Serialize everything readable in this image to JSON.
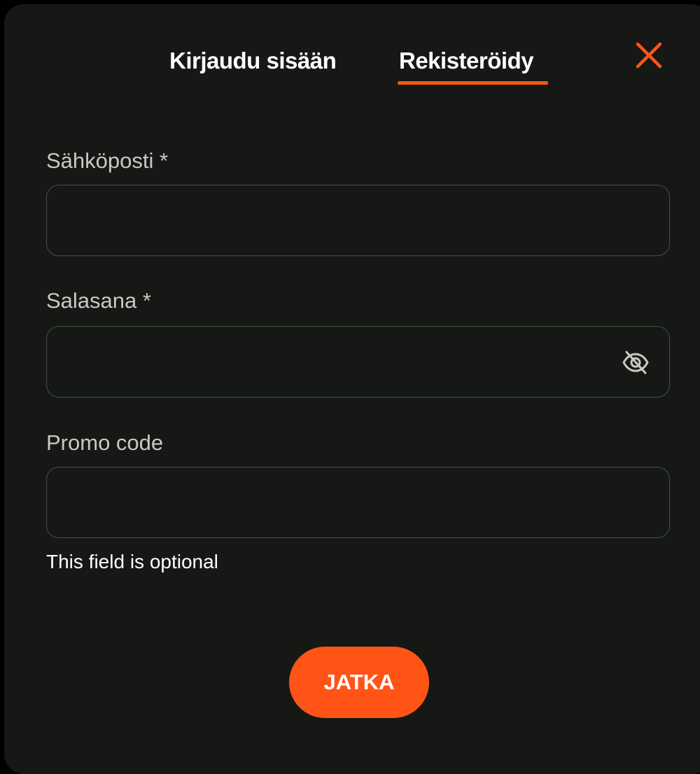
{
  "colors": {
    "background": "#151815",
    "accent": "#ff5416",
    "label": "#c7c9c5",
    "input_border": "#4a4e49"
  },
  "tabs": [
    {
      "label": "Kirjaudu sisään",
      "active": false
    },
    {
      "label": "Rekisteröidy",
      "active": true
    }
  ],
  "close_icon": "close-icon",
  "form": {
    "email": {
      "label": "Sähköposti *",
      "value": "",
      "placeholder": ""
    },
    "password": {
      "label": "Salasana *",
      "value": "",
      "placeholder": "",
      "toggle_icon": "eye-off-icon"
    },
    "promo": {
      "label": "Promo code",
      "value": "",
      "placeholder": "",
      "hint": "This field is optional"
    }
  },
  "submit_label": "JATKA"
}
